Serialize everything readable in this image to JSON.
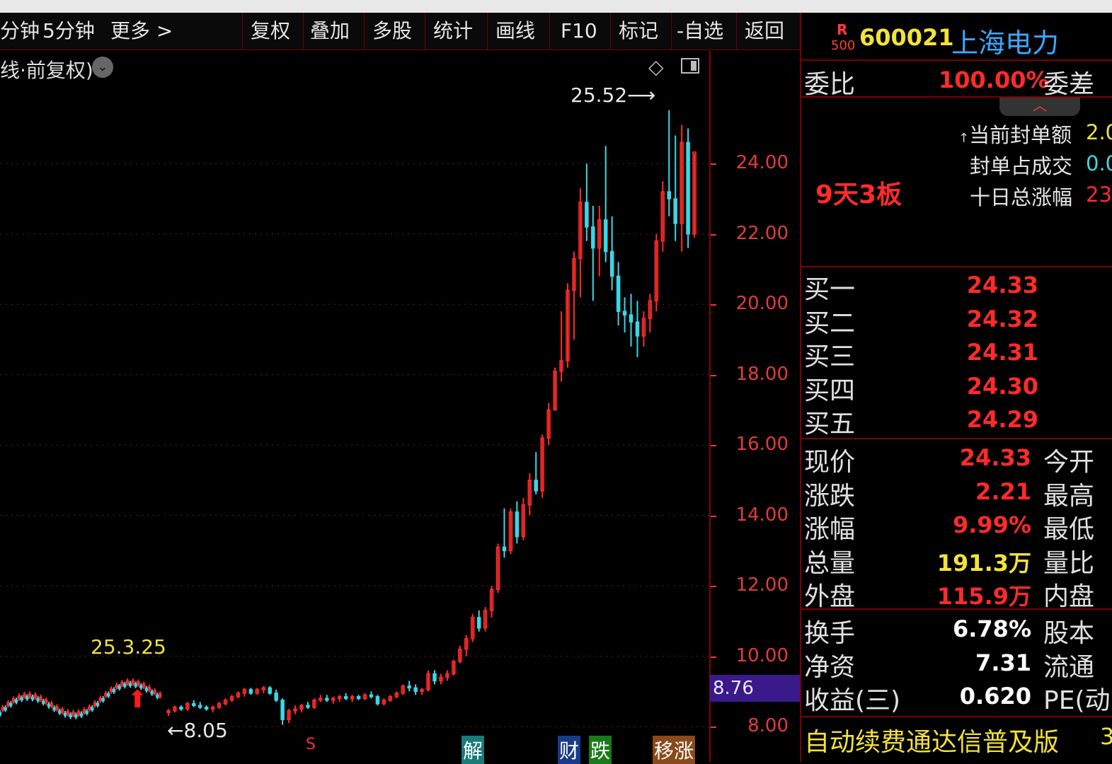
{
  "toolbar": {
    "items": [
      "分钟",
      "5分钟",
      "更多 >",
      "复权",
      "叠加",
      "多股",
      "统计",
      "画线",
      "F10",
      "标记",
      "-自选",
      "返回"
    ]
  },
  "chart": {
    "title_fragment": "线·前复权)",
    "label_high": "25.52",
    "label_low": "8.05",
    "label_date": "25.3.25",
    "current_price_box": "8.76",
    "bottom_markers": [
      "S",
      "解",
      "财",
      "跌",
      "移涨"
    ]
  },
  "chart_data": {
    "type": "candlestick",
    "ylim": [
      7.6,
      26.8
    ],
    "yticks": [
      "24.00",
      "22.00",
      "20.00",
      "18.00",
      "16.00",
      "14.00",
      "12.00",
      "10.00",
      "8.00"
    ],
    "ytick_values": [
      24,
      22,
      20,
      18,
      16,
      14,
      12,
      10,
      8
    ],
    "high_annotation": 25.52,
    "low_annotation": 8.05,
    "candles": [
      [
        8.4,
        8.5,
        8.3,
        8.45
      ],
      [
        8.45,
        8.6,
        8.4,
        8.55
      ],
      [
        8.55,
        8.6,
        8.45,
        8.5
      ],
      [
        8.5,
        8.7,
        8.45,
        8.65
      ],
      [
        8.65,
        8.75,
        8.55,
        8.6
      ],
      [
        8.6,
        8.7,
        8.5,
        8.55
      ],
      [
        8.55,
        8.6,
        8.45,
        8.5
      ],
      [
        8.5,
        8.6,
        8.4,
        8.55
      ],
      [
        8.55,
        8.7,
        8.5,
        8.65
      ],
      [
        8.65,
        8.8,
        8.6,
        8.75
      ],
      [
        8.75,
        8.9,
        8.7,
        8.85
      ],
      [
        8.85,
        9.0,
        8.8,
        8.95
      ],
      [
        8.95,
        9.1,
        8.85,
        9.05
      ],
      [
        9.05,
        9.1,
        8.9,
        8.95
      ],
      [
        8.95,
        9.1,
        8.9,
        9.05
      ],
      [
        9.05,
        9.15,
        8.95,
        9.1
      ],
      [
        9.1,
        9.15,
        8.9,
        8.95
      ],
      [
        8.95,
        9.05,
        8.7,
        8.75
      ],
      [
        8.75,
        8.8,
        8.05,
        8.2
      ],
      [
        8.2,
        8.5,
        8.1,
        8.45
      ],
      [
        8.45,
        8.6,
        8.35,
        8.5
      ],
      [
        8.5,
        8.65,
        8.4,
        8.6
      ],
      [
        8.6,
        8.7,
        8.5,
        8.55
      ],
      [
        8.55,
        8.8,
        8.5,
        8.75
      ],
      [
        8.75,
        8.9,
        8.7,
        8.8
      ],
      [
        8.8,
        8.9,
        8.7,
        8.75
      ],
      [
        8.75,
        8.85,
        8.65,
        8.8
      ],
      [
        8.8,
        8.9,
        8.7,
        8.85
      ],
      [
        8.85,
        8.95,
        8.75,
        8.8
      ],
      [
        8.8,
        8.9,
        8.7,
        8.85
      ],
      [
        8.85,
        8.9,
        8.75,
        8.8
      ],
      [
        8.8,
        8.95,
        8.75,
        8.9
      ],
      [
        8.9,
        9.0,
        8.8,
        8.85
      ],
      [
        8.85,
        8.9,
        8.6,
        8.65
      ],
      [
        8.65,
        8.8,
        8.6,
        8.75
      ],
      [
        8.75,
        8.9,
        8.7,
        8.85
      ],
      [
        8.85,
        9.0,
        8.8,
        8.95
      ],
      [
        8.95,
        9.2,
        8.9,
        9.15
      ],
      [
        9.15,
        9.3,
        9.0,
        9.1
      ],
      [
        9.1,
        9.2,
        8.9,
        9.0
      ],
      [
        9.0,
        9.1,
        8.9,
        9.05
      ],
      [
        9.05,
        9.6,
        9.0,
        9.5
      ],
      [
        9.5,
        9.6,
        9.2,
        9.3
      ],
      [
        9.3,
        9.5,
        9.2,
        9.4
      ],
      [
        9.4,
        9.6,
        9.3,
        9.5
      ],
      [
        9.5,
        9.9,
        9.45,
        9.85
      ],
      [
        9.85,
        10.3,
        9.8,
        10.2
      ],
      [
        10.2,
        10.6,
        10.0,
        10.5
      ],
      [
        10.5,
        11.2,
        10.4,
        11.1
      ],
      [
        11.1,
        11.3,
        10.7,
        10.8
      ],
      [
        10.8,
        11.4,
        10.7,
        11.3
      ],
      [
        11.3,
        12.0,
        11.1,
        11.9
      ],
      [
        11.9,
        13.2,
        11.8,
        13.1
      ],
      [
        13.1,
        14.2,
        12.8,
        13.0
      ],
      [
        13.0,
        14.2,
        12.9,
        14.1
      ],
      [
        14.1,
        14.4,
        13.2,
        13.4
      ],
      [
        13.4,
        14.5,
        13.3,
        14.3
      ],
      [
        14.3,
        15.2,
        14.0,
        15.0
      ],
      [
        15.0,
        15.8,
        14.6,
        14.7
      ],
      [
        14.7,
        16.3,
        14.5,
        16.2
      ],
      [
        16.2,
        17.2,
        16.0,
        17.0
      ],
      [
        17.0,
        18.2,
        17.0,
        18.1
      ],
      [
        18.1,
        19.8,
        17.8,
        18.4
      ],
      [
        18.4,
        20.6,
        18.2,
        20.4
      ],
      [
        20.4,
        21.5,
        19.0,
        21.3
      ],
      [
        21.3,
        23.3,
        20.2,
        22.9
      ],
      [
        22.9,
        24.0,
        21.8,
        22.2
      ],
      [
        22.2,
        22.8,
        20.1,
        21.6
      ],
      [
        21.6,
        22.8,
        20.8,
        22.4
      ],
      [
        22.4,
        24.5,
        21.2,
        21.5
      ],
      [
        21.5,
        22.5,
        20.4,
        20.8
      ],
      [
        20.8,
        21.2,
        19.4,
        19.8
      ],
      [
        19.8,
        20.2,
        19.2,
        19.7
      ],
      [
        19.7,
        20.3,
        18.8,
        19.5
      ],
      [
        19.5,
        20.1,
        18.5,
        19.1
      ],
      [
        19.1,
        19.8,
        18.8,
        19.6
      ],
      [
        19.6,
        20.3,
        19.2,
        20.1
      ],
      [
        20.1,
        22.0,
        19.8,
        21.8
      ],
      [
        21.8,
        23.5,
        21.5,
        23.2
      ],
      [
        23.2,
        25.52,
        22.5,
        23.0
      ],
      [
        23.0,
        24.8,
        21.8,
        22.3
      ],
      [
        22.3,
        25.1,
        21.5,
        24.6
      ],
      [
        24.6,
        25.0,
        21.6,
        22.0
      ],
      [
        22.0,
        24.3,
        21.9,
        24.33
      ]
    ]
  },
  "right_panel": {
    "code": "600021",
    "name": "上海电力",
    "badge_top": "R",
    "badge_bottom": "500",
    "weibi_label": "委比",
    "weibi_value": "100.00%",
    "weicha_label": "委差",
    "seal_amount_label": "当前封单额",
    "seal_amount_value": "2.0",
    "seal_ratio_label": "封单占成交",
    "seal_ratio_value": "0.0",
    "ten_day_label": "十日总涨幅",
    "ten_day_value": "23",
    "streak": "9天3板",
    "bids": [
      {
        "label": "买一",
        "value": "24.33"
      },
      {
        "label": "买二",
        "value": "24.32"
      },
      {
        "label": "买三",
        "value": "24.31"
      },
      {
        "label": "买四",
        "value": "24.30"
      },
      {
        "label": "买五",
        "value": "24.29"
      }
    ],
    "quote": [
      {
        "label": "现价",
        "value": "24.33",
        "label2": "今开"
      },
      {
        "label": "涨跌",
        "value": "2.21",
        "label2": "最高"
      },
      {
        "label": "涨幅",
        "value": "9.99%",
        "label2": "最低"
      },
      {
        "label": "总量",
        "value": "191.3万",
        "label2": "量比"
      },
      {
        "label": "外盘",
        "value": "115.9万",
        "label2": "内盘"
      }
    ],
    "stats": [
      {
        "label": "换手",
        "value": "6.78%",
        "label2": "股本"
      },
      {
        "label": "净资",
        "value": "7.31",
        "label2": "流通"
      },
      {
        "label": "收益(三)",
        "value": "0.620",
        "label2": "PE(动"
      }
    ],
    "banner": "自动续费通达信普及版",
    "banner_suffix": "3"
  },
  "colors": {
    "up": "#ff2b2b",
    "down": "#3bd7e6",
    "grid": "#8a1010",
    "axis_text": "#e23b3b"
  }
}
